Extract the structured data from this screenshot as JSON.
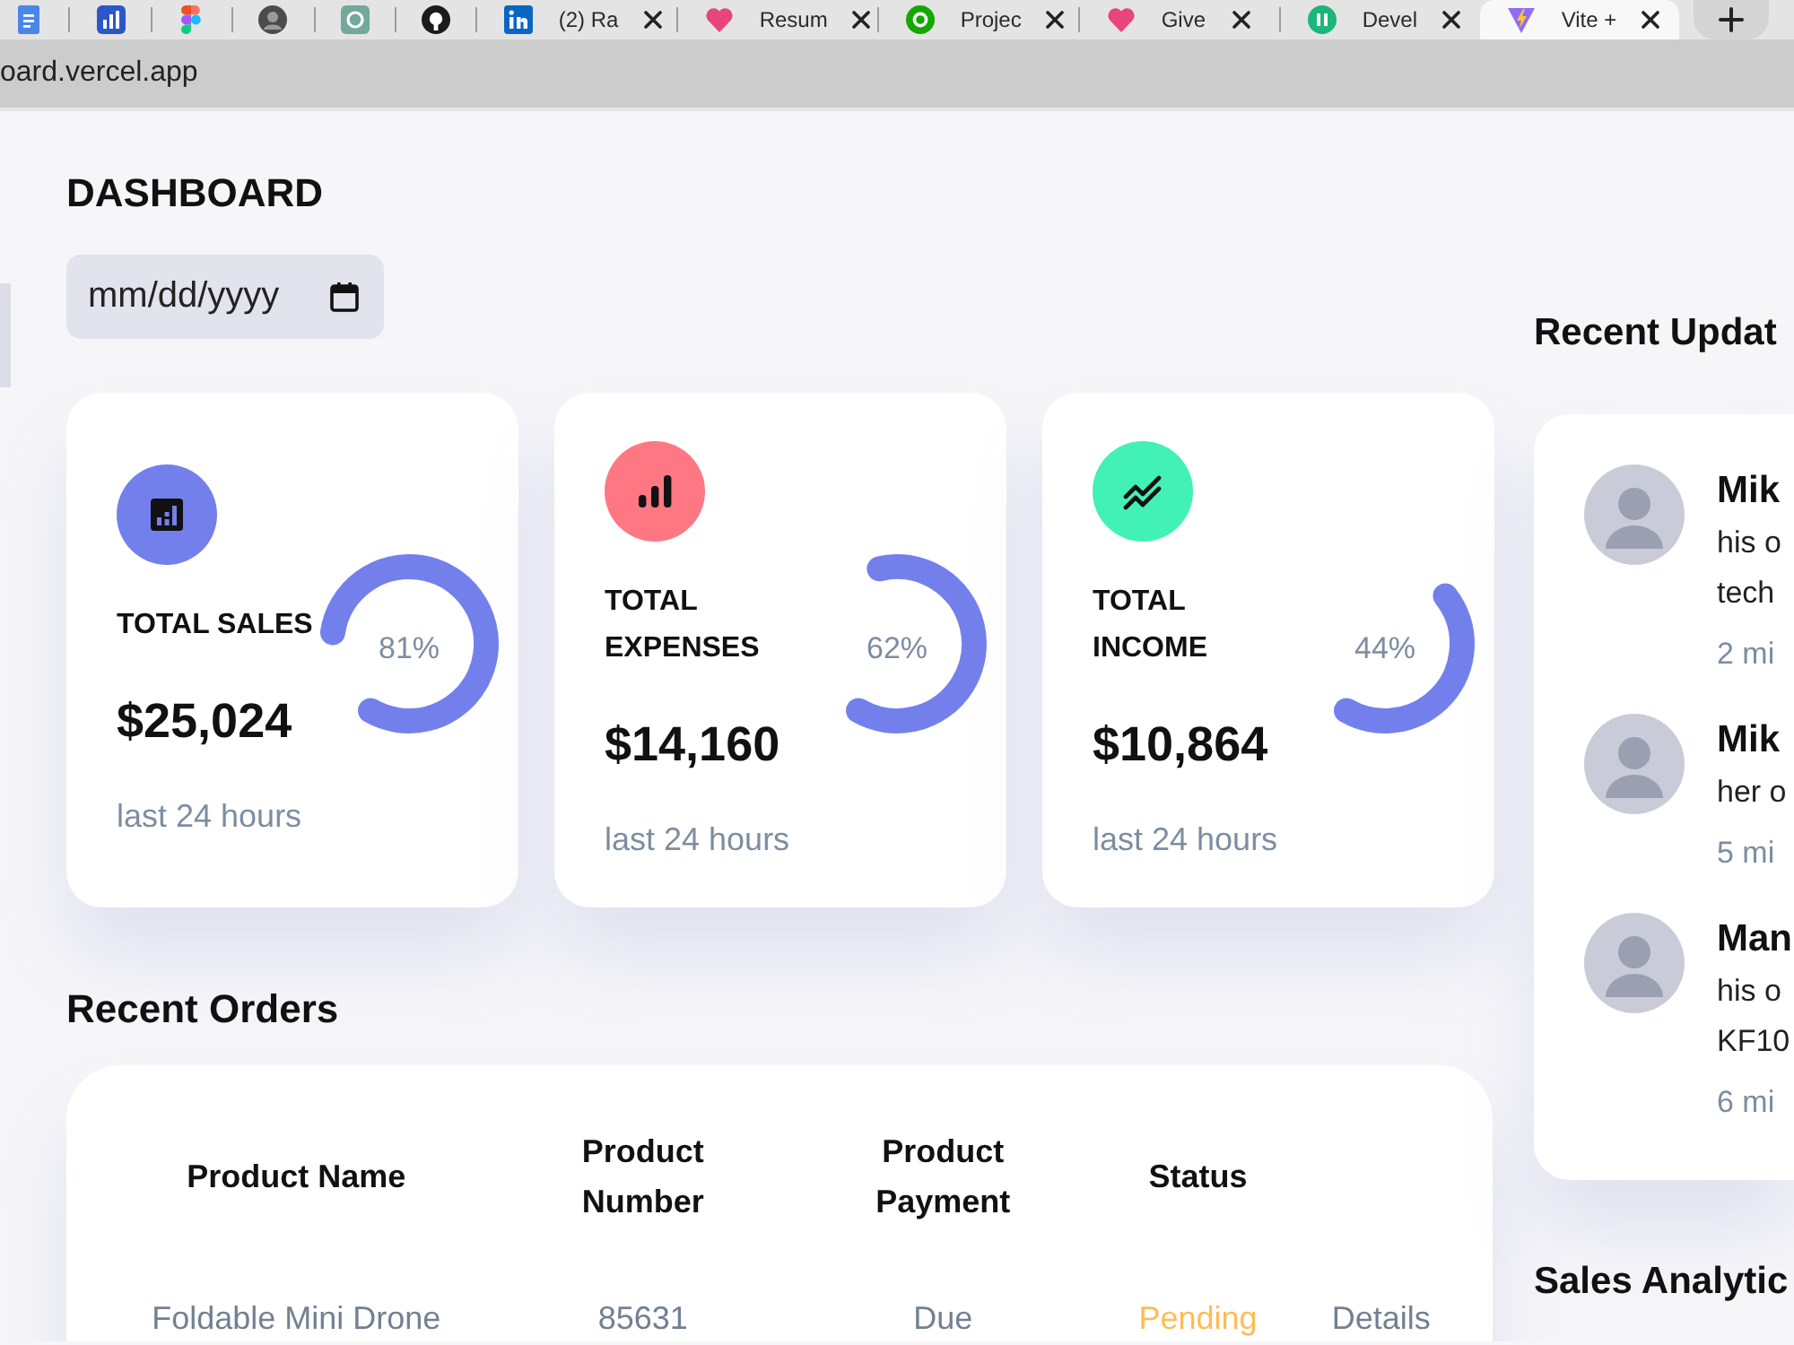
{
  "browser": {
    "tabs": [
      {
        "kind": "pinned",
        "selected": false
      },
      {
        "kind": "pinned",
        "selected": false
      },
      {
        "kind": "pinned",
        "selected": false
      },
      {
        "kind": "pinned",
        "selected": false
      },
      {
        "kind": "pinned",
        "selected": false
      },
      {
        "kind": "pinned",
        "selected": false
      },
      {
        "kind": "normal",
        "label": "(2) Ra",
        "selected": false
      },
      {
        "kind": "normal",
        "label": "Resum",
        "selected": false
      },
      {
        "kind": "normal",
        "label": "Projec",
        "selected": false
      },
      {
        "kind": "normal",
        "label": "Give",
        "selected": false
      },
      {
        "kind": "normal",
        "label": "Devel",
        "selected": false
      },
      {
        "kind": "normal",
        "label": "Vite +",
        "selected": true
      }
    ],
    "url": "oard.vercel.app"
  },
  "dashboard": {
    "title": "DASHBOARD",
    "date_field": {
      "placeholder": "mm/dd/yyyy"
    },
    "insights": [
      {
        "kind": "sales",
        "color": "#7380ec",
        "title": "TOTAL SALES",
        "amount": "$25,024",
        "level": 0.81,
        "percent": "81%",
        "period": "last 24 hours"
      },
      {
        "kind": "expenses",
        "color": "#ff7782",
        "title": "TOTAL EXPENSES",
        "amount": "$14,160",
        "level": 0.62,
        "percent": "62%",
        "period": "last 24 hours"
      },
      {
        "kind": "income",
        "color": "#41f1b6",
        "title": "TOTAL INCOME",
        "amount": "$10,864",
        "level": 0.44,
        "percent": "44%",
        "period": "last 24 hours"
      }
    ]
  },
  "recent_orders": {
    "title": "Recent Orders",
    "columns": [
      "Product Name",
      "Product Number",
      "Product Payment",
      "Status"
    ],
    "rows": [
      {
        "product_name": "Foldable Mini Drone",
        "product_number": "85631",
        "payment": "Due",
        "status": "Pending",
        "color": "#ffbb55",
        "action": "Details"
      }
    ]
  },
  "recent_updates": {
    "title": "Recent Updat",
    "items": [
      {
        "name": "Mik",
        "message_lines": [
          "his o",
          "tech"
        ],
        "time": "2 mi"
      },
      {
        "name": "Mik",
        "message_lines": [
          "her o"
        ],
        "time": "5 mi"
      },
      {
        "name": "Man",
        "message_lines": [
          "his o",
          "KF10"
        ],
        "time": "6 mi"
      }
    ]
  },
  "sales_analytics": {
    "title": "Sales Analytic"
  }
}
